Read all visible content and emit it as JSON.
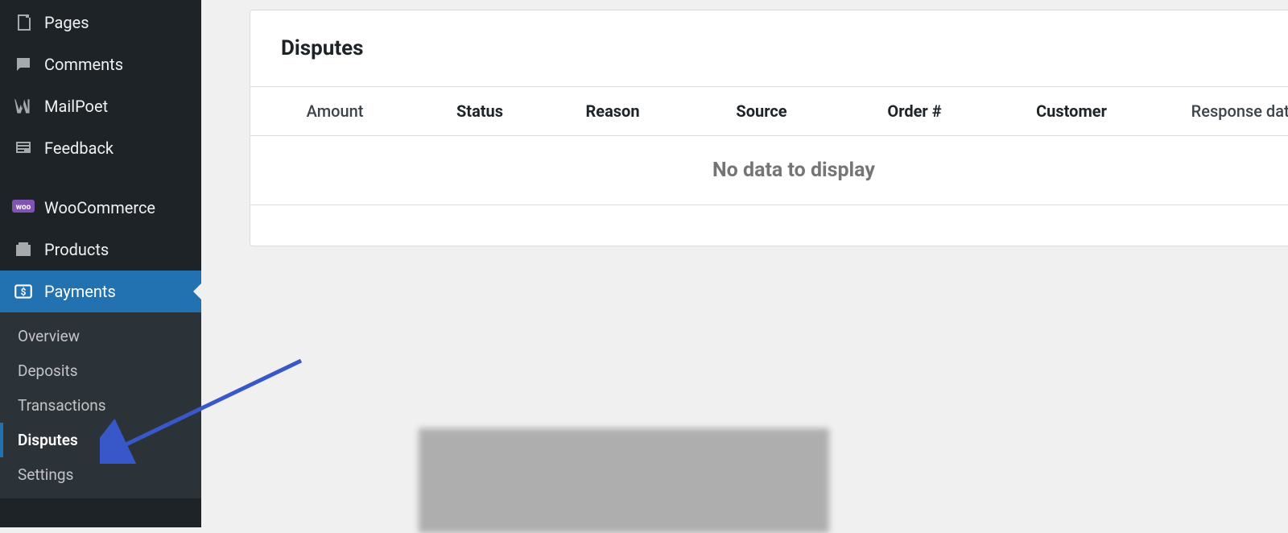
{
  "sidebar": {
    "items": [
      {
        "label": "Pages",
        "icon": "pages"
      },
      {
        "label": "Comments",
        "icon": "comment"
      },
      {
        "label": "MailPoet",
        "icon": "mailpoet"
      },
      {
        "label": "Feedback",
        "icon": "feedback"
      }
    ],
    "group2": [
      {
        "label": "WooCommerce",
        "icon": "woo"
      },
      {
        "label": "Products",
        "icon": "products"
      }
    ],
    "active": {
      "label": "Payments",
      "icon": "payments"
    },
    "sub": [
      {
        "label": "Overview"
      },
      {
        "label": "Deposits"
      },
      {
        "label": "Transactions"
      },
      {
        "label": "Disputes"
      },
      {
        "label": "Settings"
      }
    ]
  },
  "panel": {
    "title": "Disputes",
    "columns": {
      "amount": "Amount",
      "status": "Status",
      "reason": "Reason",
      "source": "Source",
      "order": "Order #",
      "customer": "Customer",
      "response": "Response date"
    },
    "empty": "No data to display"
  }
}
